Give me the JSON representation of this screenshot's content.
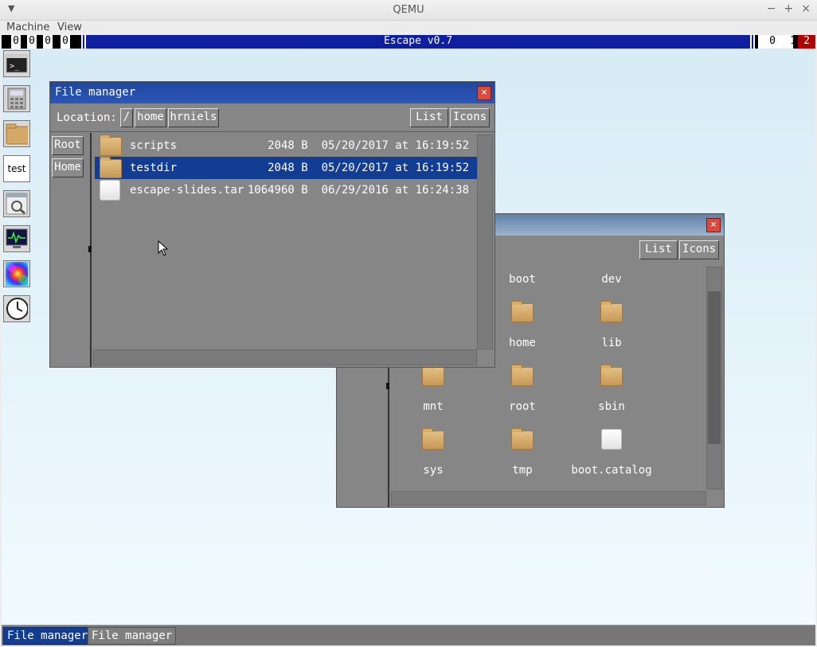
{
  "host": {
    "title": "QEMU",
    "menu": [
      "Machine",
      "View"
    ],
    "window_buttons": [
      "−",
      "+",
      "×"
    ]
  },
  "status": {
    "cpus_left": [
      "0",
      "0",
      "0",
      "0"
    ],
    "title": "Escape v0.7",
    "right": [
      "0",
      "1",
      "2"
    ],
    "colors": {
      "bar": "#0f1f9e",
      "alert": "#b00000"
    }
  },
  "dock": [
    {
      "name": "terminal-icon"
    },
    {
      "name": "calculator-icon"
    },
    {
      "name": "folder-icon"
    },
    {
      "name": "text-test-icon",
      "label": "test"
    },
    {
      "name": "settings-icon"
    },
    {
      "name": "system-monitor-icon"
    },
    {
      "name": "plasma-icon"
    },
    {
      "name": "clock-icon"
    }
  ],
  "front_window": {
    "title": "File manager",
    "close": "×",
    "location_label": "Location:",
    "crumbs": [
      "/",
      "home",
      "hrniels"
    ],
    "view_buttons": [
      "List",
      "Icons"
    ],
    "side_buttons": [
      "Root",
      "Home"
    ],
    "files": [
      {
        "name": "scripts",
        "size": "2048 B",
        "date": "05/20/2017 at 16:19:52",
        "type": "folder",
        "selected": false
      },
      {
        "name": "testdir",
        "size": "2048 B",
        "date": "05/20/2017 at 16:19:52",
        "type": "folder",
        "selected": true
      },
      {
        "name": "escape-slides.tar",
        "size": "1064960 B",
        "date": "06/29/2016 at 16:24:38",
        "type": "file",
        "selected": false
      }
    ]
  },
  "back_window": {
    "close": "×",
    "view_buttons": [
      "List",
      "Icons"
    ],
    "icons": [
      {
        "label": "boot",
        "type": "folder"
      },
      {
        "label": "dev",
        "type": "folder"
      },
      {
        "label": "home",
        "type": "folder"
      },
      {
        "label": "lib",
        "type": "folder"
      },
      {
        "label": "mnt",
        "type": "folder"
      },
      {
        "label": "root",
        "type": "folder"
      },
      {
        "label": "sbin",
        "type": "folder"
      },
      {
        "label": "sys",
        "type": "folder"
      },
      {
        "label": "tmp",
        "type": "folder"
      },
      {
        "label": "boot.catalog",
        "type": "file"
      }
    ]
  },
  "taskbar": [
    {
      "label": "File manager",
      "active": true
    },
    {
      "label": "File manager",
      "active": false
    }
  ]
}
